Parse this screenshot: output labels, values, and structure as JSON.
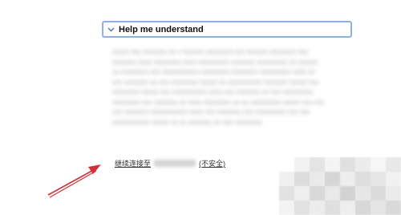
{
  "help": {
    "title": "Help me understand",
    "expanded": true
  },
  "continue": {
    "link_text": "继续连接至",
    "host": "",
    "suffix": "(不安全)"
  },
  "colors": {
    "box_border": "#8fb0e0",
    "arrow": "#d0303a"
  },
  "icons": {
    "chevron": "chevron-down-icon"
  }
}
